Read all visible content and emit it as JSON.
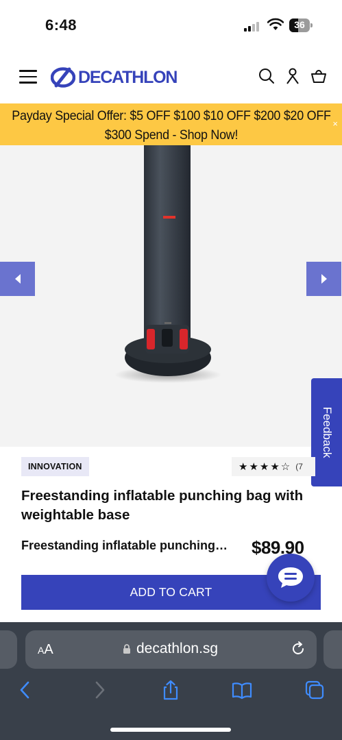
{
  "status_bar": {
    "time": "6:48",
    "battery": "36"
  },
  "header": {
    "brand": "DECATHLON"
  },
  "promo": {
    "text": "Payday Special Offer: $5 OFF $100 $10 OFF $200 $20 OFF $300 Spend - Shop Now!",
    "close": "×"
  },
  "feedback": {
    "label": "Feedback"
  },
  "product": {
    "badge": "INNOVATION",
    "stars": "★★★★☆",
    "rating_count": "(7",
    "title": "Freestanding inflatable punching bag with weightable base",
    "subtitle": "Freestanding inflatable punching bag with weightable base",
    "price": "$89.90",
    "add_to_cart": "ADD TO CART"
  },
  "browser": {
    "aa_small": "A",
    "aa_large": "A",
    "url": "decathlon.sg"
  },
  "colors": {
    "brand": "#3643ba",
    "promo": "#fdc844",
    "arrow": "#6a73cf",
    "safari": "#39404a"
  }
}
